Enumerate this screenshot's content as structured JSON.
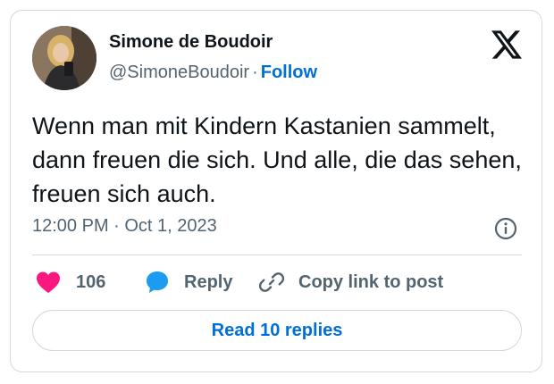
{
  "author": {
    "display_name": "Simone de Boudoir",
    "handle": "@SimoneBoudoir",
    "separator": "·",
    "follow_label": "Follow"
  },
  "tweet": {
    "text": "Wenn man mit Kindern Kastanien sammelt, dann freuen die sich. Und alle, die das sehen, freuen sich auch.",
    "timestamp": "12:00 PM · Oct 1, 2023"
  },
  "actions": {
    "like_count": "106",
    "reply_label": "Reply",
    "copy_link_label": "Copy link to post"
  },
  "footer": {
    "read_replies_label": "Read 10 replies"
  },
  "icons": {
    "platform_logo": "x-logo-icon",
    "info": "info-icon",
    "like": "heart-icon",
    "reply": "speech-bubble-icon",
    "copy_link": "link-icon"
  },
  "colors": {
    "link_blue": "#006fd6",
    "like_pink": "#f91880",
    "reply_blue": "#1d9bf0",
    "secondary_text": "#536471",
    "border": "#cfd9de"
  }
}
